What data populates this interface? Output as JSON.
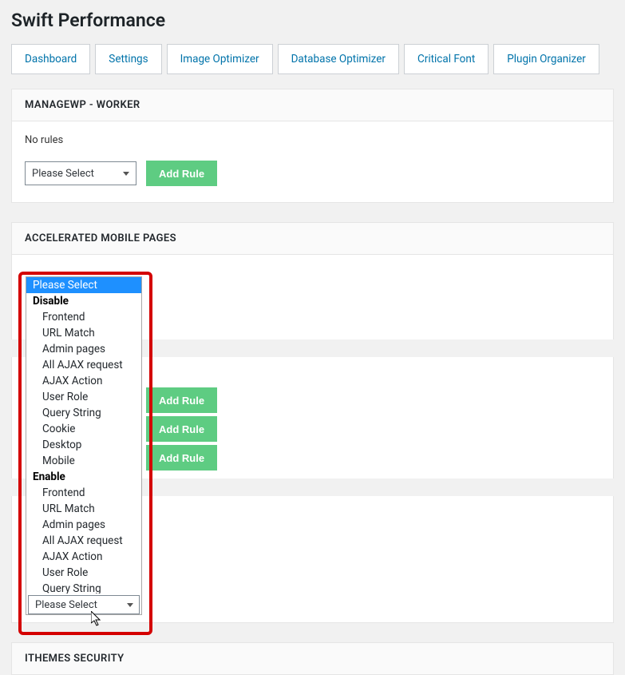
{
  "page_title": "Swift Performance",
  "tabs": [
    "Dashboard",
    "Settings",
    "Image Optimizer",
    "Database Optimizer",
    "Critical Font",
    "Plugin Organizer"
  ],
  "panel1": {
    "title": "MANAGEWP - WORKER",
    "no_rules": "No rules",
    "select_placeholder": "Please Select",
    "add_button": "Add Rule"
  },
  "panel2": {
    "title": "ACCELERATED MOBILE PAGES",
    "add_button": "Add Rule",
    "select_placeholder": "Please Select"
  },
  "panel3": {
    "title": "ITHEMES SECURITY"
  },
  "dropdown": {
    "selected": "Please Select",
    "under_select": "Please Select",
    "group_disable": "Disable",
    "group_enable": "Enable",
    "disable_items": [
      "Frontend",
      "URL Match",
      "Admin pages",
      "All AJAX request",
      "AJAX Action",
      "User Role",
      "Query String",
      "Cookie",
      "Desktop",
      "Mobile"
    ],
    "enable_items": [
      "Frontend",
      "URL Match",
      "Admin pages",
      "All AJAX request",
      "AJAX Action",
      "User Role",
      "Query String"
    ]
  }
}
